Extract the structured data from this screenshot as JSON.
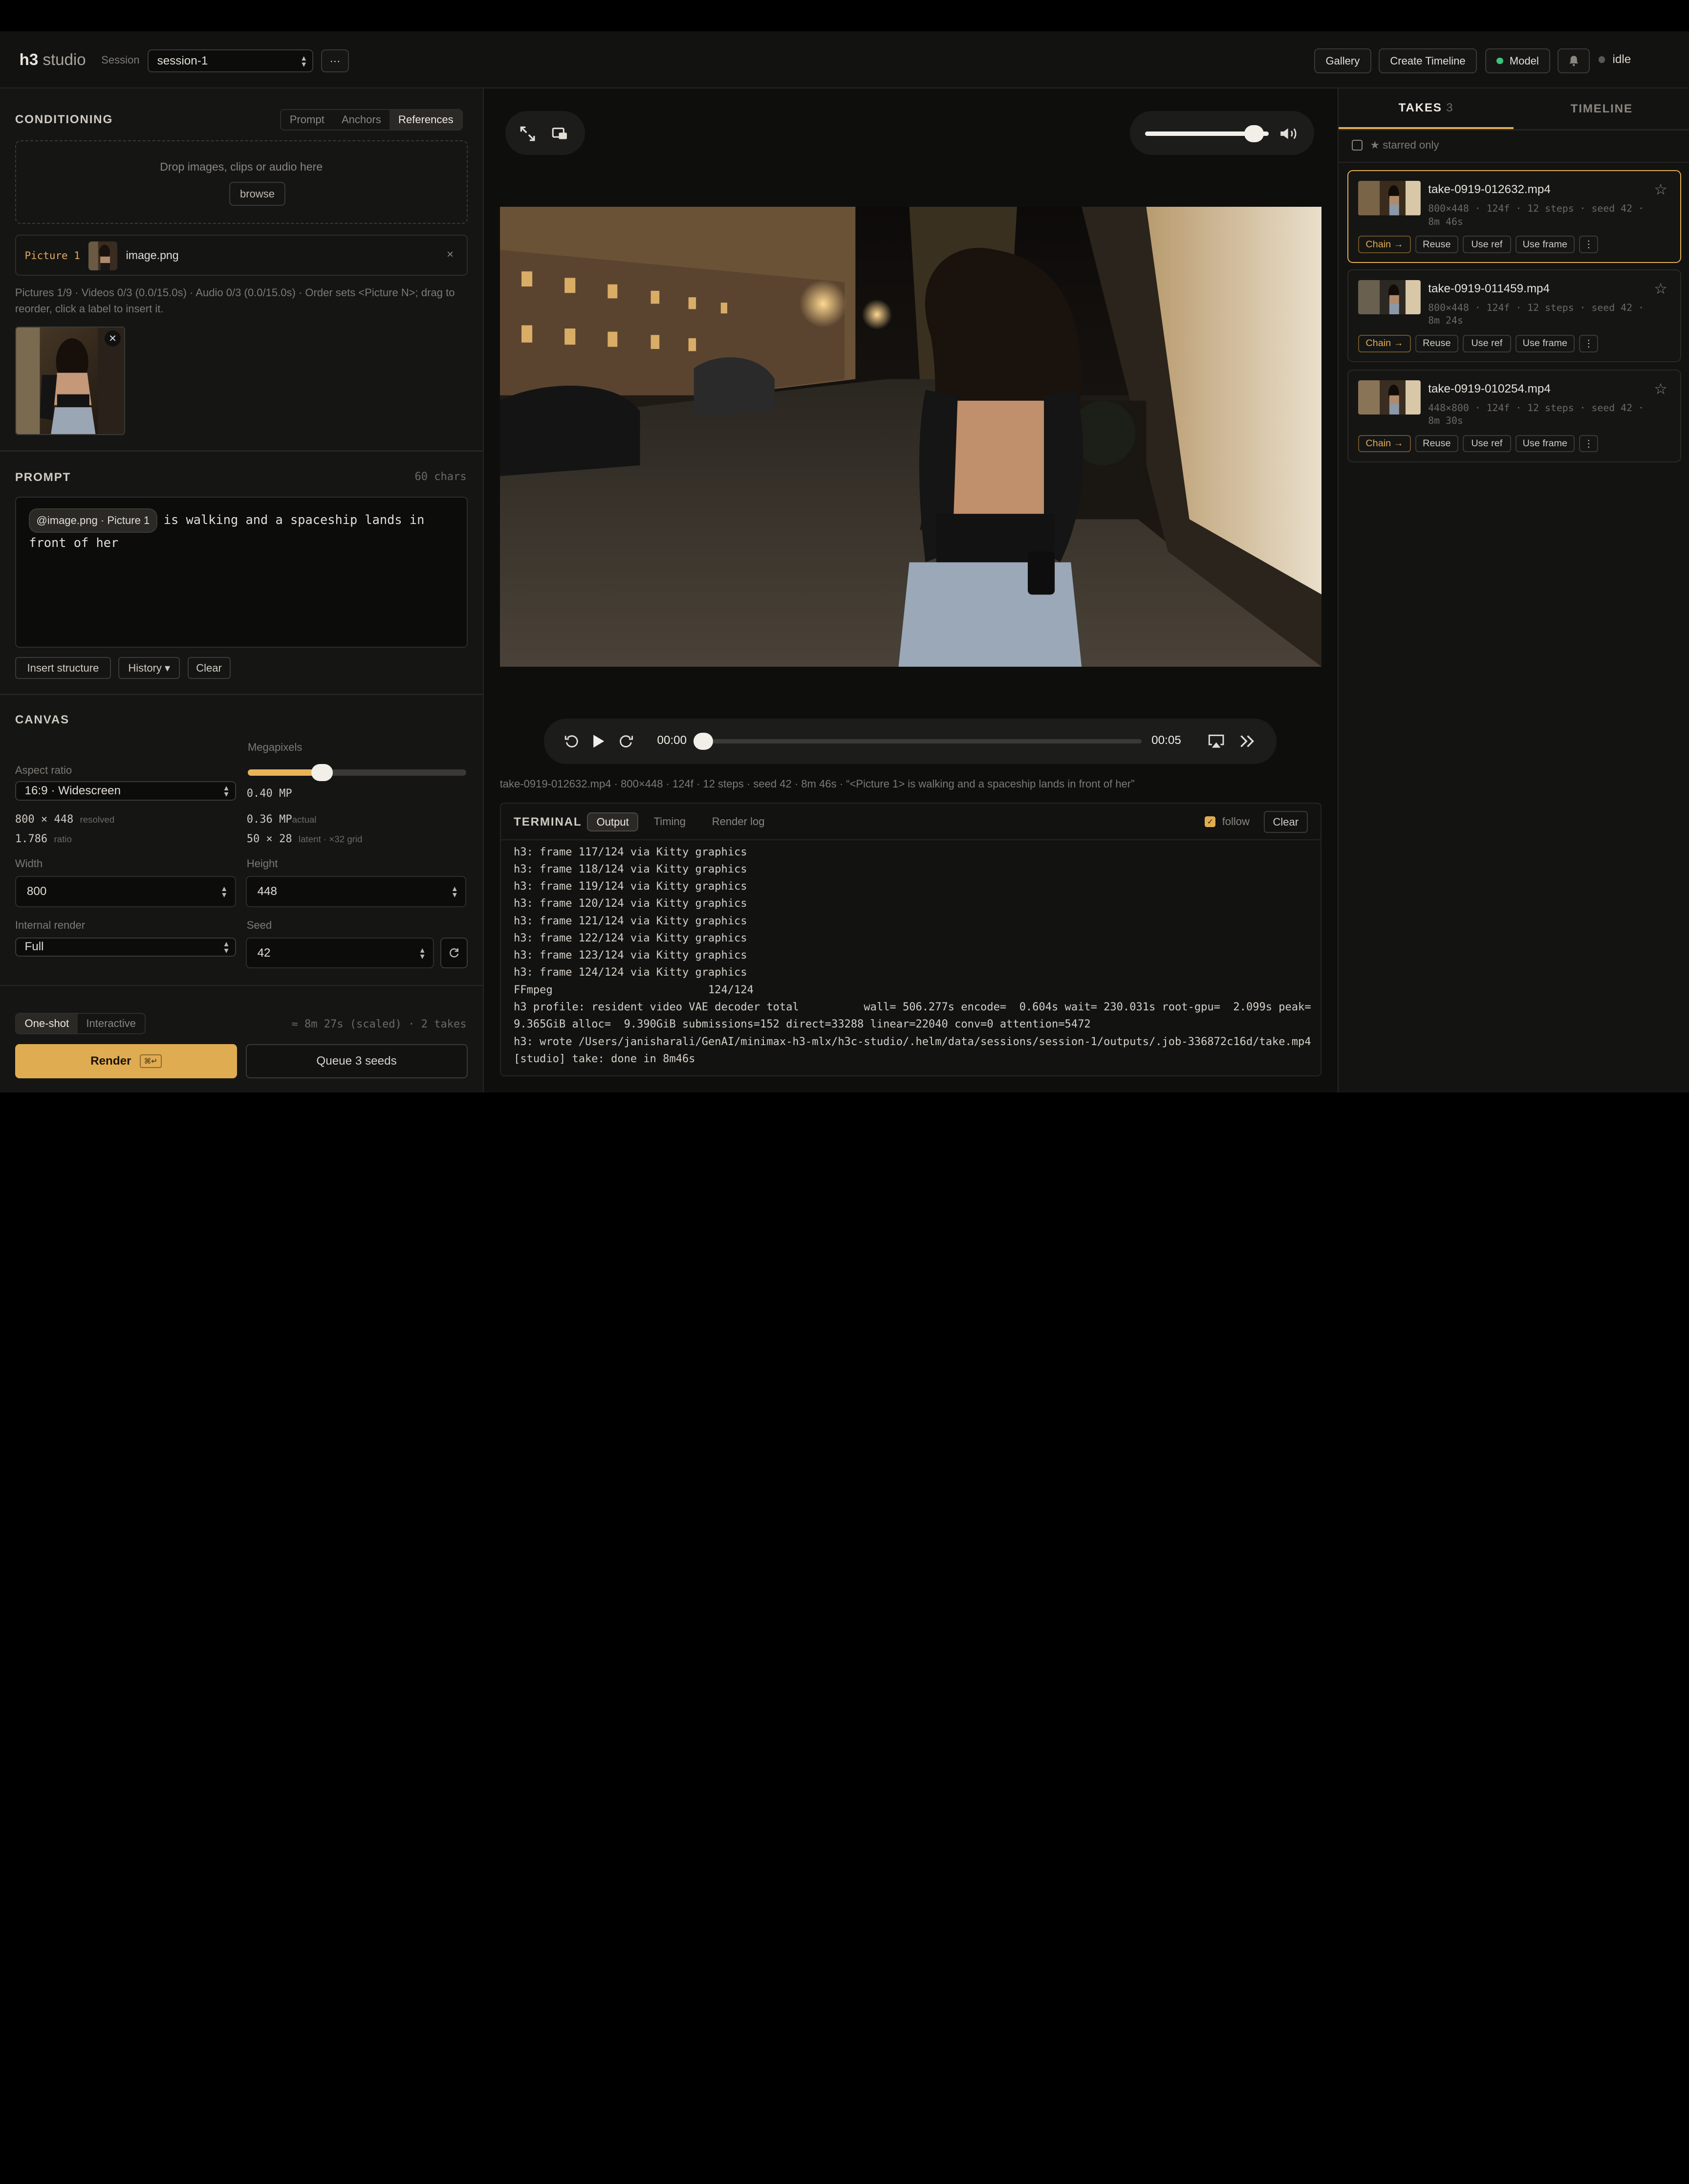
{
  "header": {
    "logo_bold": "h3",
    "logo_light": "studio",
    "session_label": "Session",
    "session_value": "session-1",
    "more_label": "···",
    "gallery": "Gallery",
    "create_timeline": "Create Timeline",
    "model": "Model",
    "status": "idle"
  },
  "conditioning": {
    "title": "CONDITIONING",
    "tabs": [
      "Prompt",
      "Anchors",
      "References"
    ],
    "active_tab": "References",
    "drop_text": "Drop images, clips or audio here",
    "browse": "browse",
    "picture_label": "Picture 1",
    "picture_file": "image.png",
    "info": "Pictures 1/9 · Videos 0/3 (0.0/15.0s) · Audio 0/3 (0.0/15.0s) · Order sets <Picture N>; drag to reorder, click a label to insert it."
  },
  "prompt": {
    "title": "PROMPT",
    "chars": "60 chars",
    "chip": "@image.png · Picture 1",
    "text": "is walking and a spaceship lands in front of her",
    "insert_structure": "Insert structure",
    "history": "History ▾",
    "clear": "Clear"
  },
  "canvas": {
    "title": "CANVAS",
    "megapixels_label": "Megapixels",
    "megapixels_value": "0.40",
    "megapixels_unit": "MP",
    "megapixels_fraction": 0.34,
    "aspect_label": "Aspect ratio",
    "aspect_value": "16:9 · Widescreen",
    "resolved_w": "800",
    "resolved_h": "448",
    "resolved_note": "resolved",
    "ratio": "1.786",
    "ratio_note": "ratio",
    "actual_mp": "0.36",
    "actual_unit": "MP",
    "actual_note": "actual",
    "latent_w": "50",
    "latent_h": "28",
    "latent_note": "latent · ×32 grid",
    "width_label": "Width",
    "width_value": "800",
    "height_label": "Height",
    "height_value": "448",
    "internal_label": "Internal render",
    "internal_value": "Full",
    "seed_label": "Seed",
    "seed_value": "42"
  },
  "render": {
    "modes": [
      "One-shot",
      "Interactive"
    ],
    "active_mode": "One-shot",
    "estimate": "≈ 8m 27s (scaled) · 2 takes",
    "render_label": "Render",
    "render_kbd": "⌘↵",
    "queue_label": "Queue 3 seeds"
  },
  "player": {
    "volume": 0.88,
    "time_current": "00:00",
    "time_total": "00:05",
    "progress": 0.0,
    "meta": "take-0919-012632.mp4 · 800×448 · 124f · 12 steps · seed 42 · 8m 46s · “<Picture 1> is walking and a spaceship lands in front of her”"
  },
  "terminal": {
    "title": "TERMINAL",
    "tabs": [
      "Output",
      "Timing",
      "Render log"
    ],
    "active_tab": "Output",
    "follow": "follow",
    "clear": "Clear",
    "lines": [
      "h3: frame 117/124 via Kitty graphics",
      "h3: frame 118/124 via Kitty graphics",
      "h3: frame 119/124 via Kitty graphics",
      "h3: frame 120/124 via Kitty graphics",
      "h3: frame 121/124 via Kitty graphics",
      "h3: frame 122/124 via Kitty graphics",
      "h3: frame 123/124 via Kitty graphics",
      "h3: frame 124/124 via Kitty graphics",
      "FFmpeg                        124/124",
      "h3 profile: resident video VAE decoder total          wall= 506.277s encode=  0.604s wait= 230.031s root-gpu=  2.099s peak=",
      "9.365GiB alloc=  9.390GiB submissions=152 direct=33288 linear=22040 conv=0 attention=5472",
      "h3: wrote /Users/janisharali/GenAI/minimax-h3-mlx/h3c-studio/.helm/data/sessions/session-1/outputs/.job-336872c16d/take.mp4",
      "[studio] take: done in 8m46s"
    ]
  },
  "takes": {
    "tab_takes": "TAKES",
    "count": "3",
    "tab_timeline": "TIMELINE",
    "starred_only": "★ starred only",
    "items": [
      {
        "name": "take-0919-012632.mp4",
        "meta": "800×448 · 124f · 12 steps · seed 42 · 8m 46s"
      },
      {
        "name": "take-0919-011459.mp4",
        "meta": "800×448 · 124f · 12 steps · seed 42 · 8m 24s"
      },
      {
        "name": "take-0919-010254.mp4",
        "meta": "448×800 · 124f · 12 steps · seed 42 · 8m 30s"
      }
    ],
    "actions": {
      "chain": "Chain →",
      "reuse": "Reuse",
      "use_ref": "Use ref",
      "use_frame": "Use frame",
      "more": "⋮"
    }
  }
}
